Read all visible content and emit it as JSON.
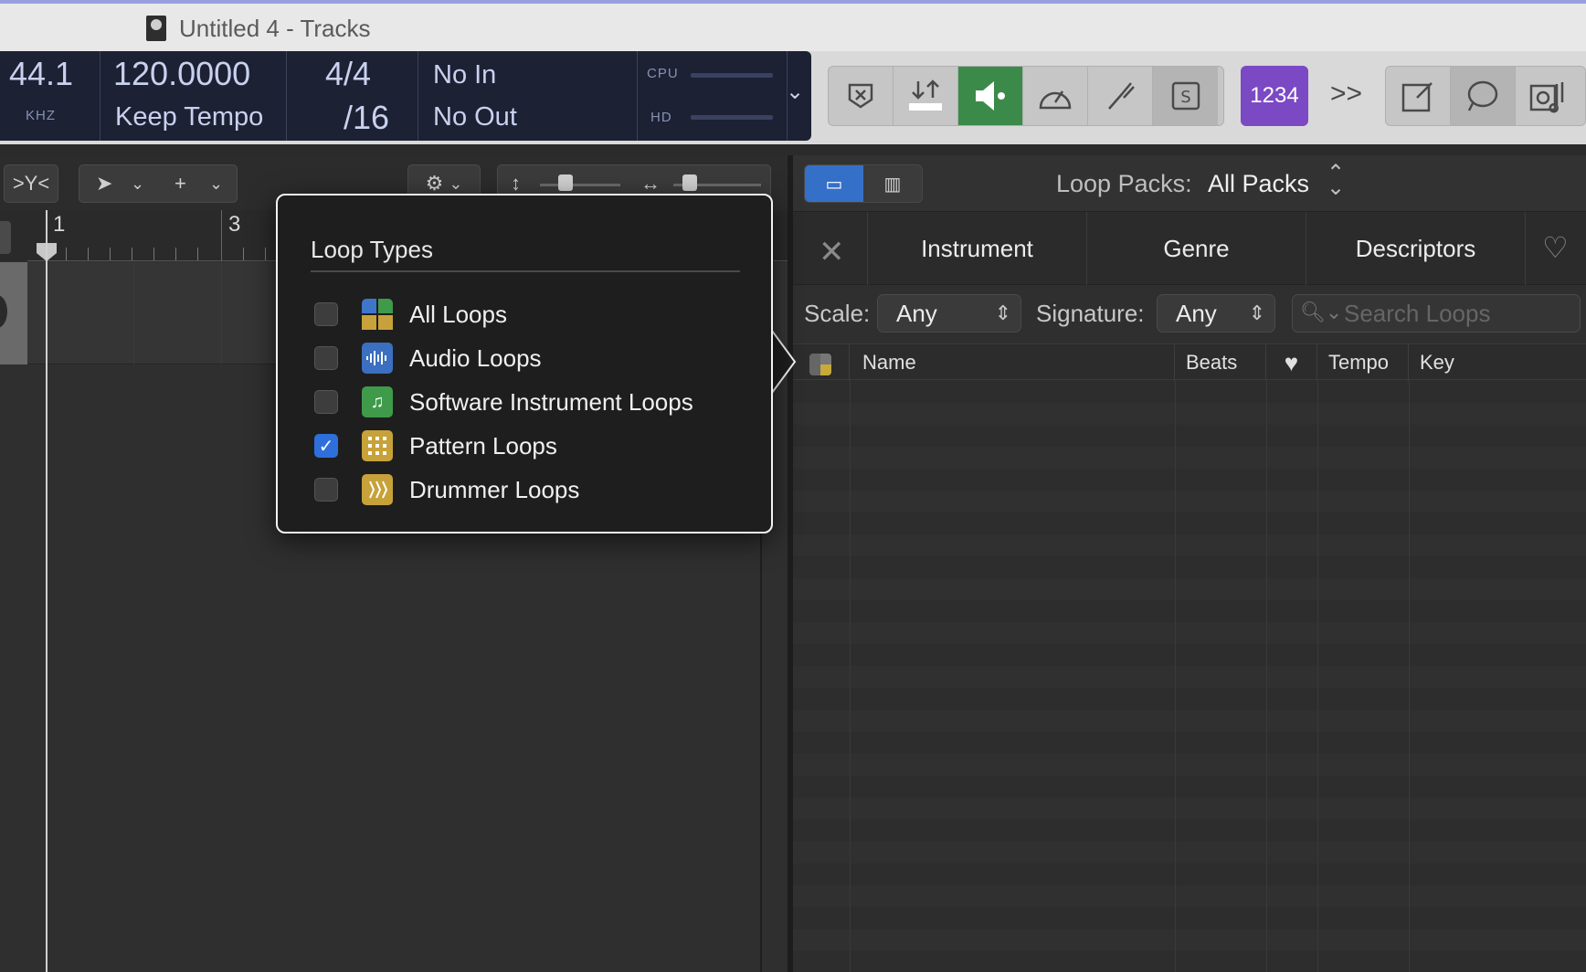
{
  "window": {
    "title": "Untitled 4 - Tracks"
  },
  "lcd": {
    "sample_rate": "44.1",
    "sample_unit": "KHZ",
    "tempo": "120.0000",
    "tempo_mode": "Keep Tempo",
    "time_sig": "4/4",
    "division": "/16",
    "input": "No In",
    "output": "No Out",
    "cpu_label": "CPU",
    "hd_label": "HD"
  },
  "control_bar": {
    "count_in_label": "1234",
    "more_label": ">>"
  },
  "tracks": {
    "ruler_marks": [
      "1",
      "3"
    ]
  },
  "loop_types_popover": {
    "title": "Loop Types",
    "items": [
      {
        "label": "All Loops",
        "checked": false,
        "icon": "all-loops-icon",
        "color": "#3e76c9"
      },
      {
        "label": "Audio Loops",
        "checked": false,
        "icon": "audio-waveform-icon",
        "color": "#3b6fc0"
      },
      {
        "label": "Software Instrument Loops",
        "checked": false,
        "icon": "music-note-icon",
        "color": "#3f9a4a"
      },
      {
        "label": "Pattern Loops",
        "checked": true,
        "icon": "pattern-grid-icon",
        "color": "#c7a23a"
      },
      {
        "label": "Drummer Loops",
        "checked": false,
        "icon": "drummer-icon",
        "color": "#c7a23a"
      }
    ]
  },
  "loop_browser": {
    "packs_label": "Loop Packs:",
    "packs_value": "All Packs",
    "tabs": [
      "Instrument",
      "Genre",
      "Descriptors"
    ],
    "scale_label": "Scale:",
    "scale_value": "Any",
    "signature_label": "Signature:",
    "signature_value": "Any",
    "search_placeholder": "Search Loops",
    "columns": {
      "name": "Name",
      "beats": "Beats",
      "favorite": "♥",
      "tempo": "Tempo",
      "key": "Key"
    }
  }
}
